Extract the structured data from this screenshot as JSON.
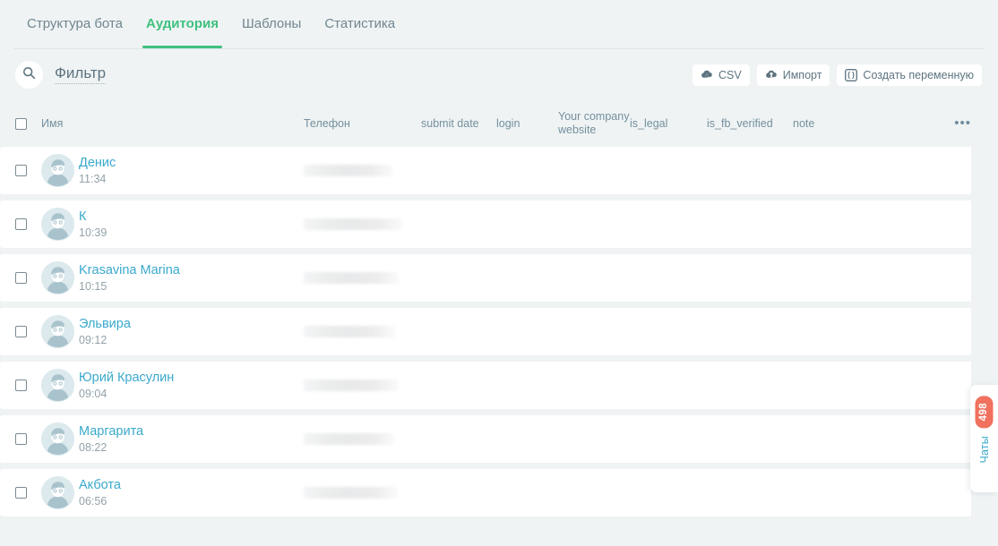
{
  "tabs": [
    {
      "label": "Структура бота",
      "active": false
    },
    {
      "label": "Аудитория",
      "active": true
    },
    {
      "label": "Шаблоны",
      "active": false
    },
    {
      "label": "Статистика",
      "active": false
    }
  ],
  "toolbar": {
    "search_icon": "search-icon",
    "filter_label": "Фильтр",
    "buttons": [
      {
        "label": "CSV",
        "icon": "cloud-download-icon"
      },
      {
        "label": "Импорт",
        "icon": "cloud-upload-icon"
      },
      {
        "label": "Создать переменную",
        "icon": "braces-icon"
      }
    ]
  },
  "table": {
    "more_menu": "•••",
    "columns": [
      {
        "key": "check",
        "label": ""
      },
      {
        "key": "name",
        "label": "Имя"
      },
      {
        "key": "phone",
        "label": "Телефон"
      },
      {
        "key": "submit_date",
        "label": "submit date"
      },
      {
        "key": "login",
        "label": "login"
      },
      {
        "key": "company_website",
        "label": "Your company website"
      },
      {
        "key": "is_legal",
        "label": "is_legal"
      },
      {
        "key": "is_fb_verified",
        "label": "is_fb_verified"
      },
      {
        "key": "note",
        "label": "note"
      }
    ],
    "rows": [
      {
        "name": "Денис",
        "time": "11:34",
        "phone_redacted": true,
        "phone_width": 99
      },
      {
        "name": "К",
        "time": "10:39",
        "phone_redacted": true,
        "phone_width": 110
      },
      {
        "name": "Krasavina Marina",
        "time": "10:15",
        "phone_redacted": true,
        "phone_width": 106
      },
      {
        "name": "Эльвира",
        "time": "09:12",
        "phone_redacted": true,
        "phone_width": 102
      },
      {
        "name": "Юрий Красулин",
        "time": "09:04",
        "phone_redacted": true,
        "phone_width": 105
      },
      {
        "name": "Маргарита",
        "time": "08:22",
        "phone_redacted": true,
        "phone_width": 101
      },
      {
        "name": "Акбота",
        "time": "06:56",
        "phone_redacted": true,
        "phone_width": 104
      }
    ]
  },
  "chats_panel": {
    "count": "498",
    "label": "Чаты"
  },
  "colors": {
    "page_bg": "#eff3f4",
    "accent_green": "#3fc17f",
    "link_blue": "#3aa9cc",
    "muted": "#74909d",
    "badge_red": "#f1705e"
  }
}
